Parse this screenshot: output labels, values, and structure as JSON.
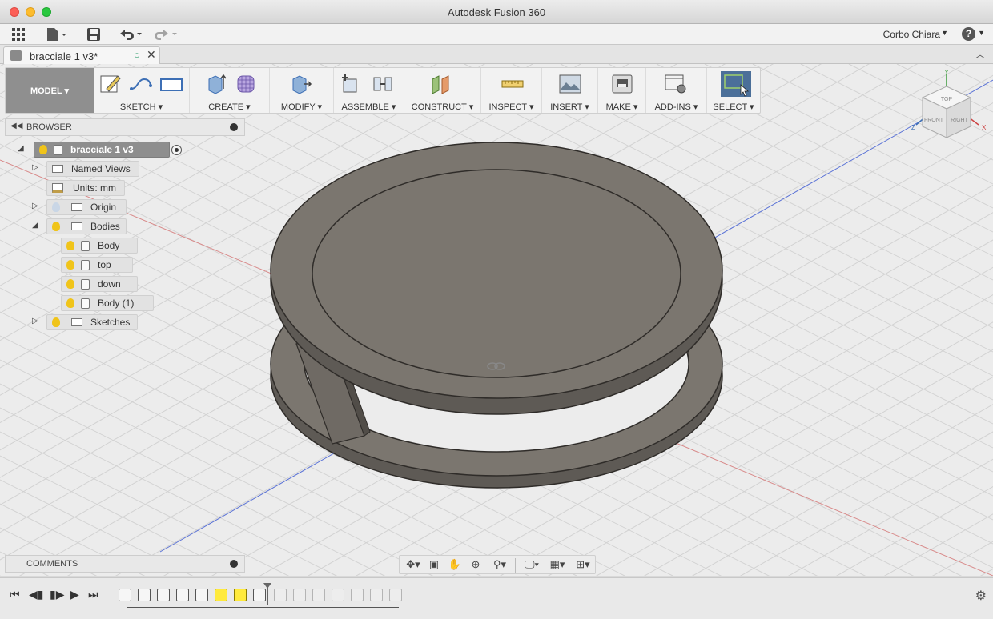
{
  "window": {
    "title": "Autodesk Fusion 360"
  },
  "app_toolbar": {
    "user_name": "Corbo Chiara",
    "help_label": "?"
  },
  "document_tab": {
    "label": "bracciale 1 v3*"
  },
  "ribbon": {
    "workspace": "MODEL ▾",
    "groups": [
      {
        "label": "SKETCH ▾"
      },
      {
        "label": "CREATE ▾"
      },
      {
        "label": "MODIFY ▾"
      },
      {
        "label": "ASSEMBLE ▾"
      },
      {
        "label": "CONSTRUCT ▾"
      },
      {
        "label": "INSPECT ▾"
      },
      {
        "label": "INSERT ▾"
      },
      {
        "label": "MAKE ▾"
      },
      {
        "label": "ADD-INS ▾"
      },
      {
        "label": "SELECT ▾"
      }
    ]
  },
  "browser": {
    "title": "BROWSER",
    "root": "bracciale 1 v3",
    "items": [
      {
        "label": "Named Views"
      },
      {
        "label": "Units: mm"
      },
      {
        "label": "Origin"
      },
      {
        "label": "Bodies"
      },
      {
        "label": "Body"
      },
      {
        "label": "top"
      },
      {
        "label": "down"
      },
      {
        "label": "Body (1)"
      },
      {
        "label": "Sketches"
      }
    ]
  },
  "viewcube": {
    "faces": {
      "top": "TOP",
      "front": "FRONT",
      "right": "RIGHT"
    },
    "axes": {
      "x": "X",
      "y": "Y",
      "z": "Z"
    }
  },
  "comments": {
    "title": "COMMENTS"
  },
  "colors": {
    "model_face": "#7b766f",
    "model_shade": "#5e5a55",
    "model_edge": "#2f2c29",
    "grid": "#d2d2d2",
    "axis_blue": "#5b73d6",
    "axis_red": "#d88a8a",
    "select_active": "#4b6f99"
  }
}
